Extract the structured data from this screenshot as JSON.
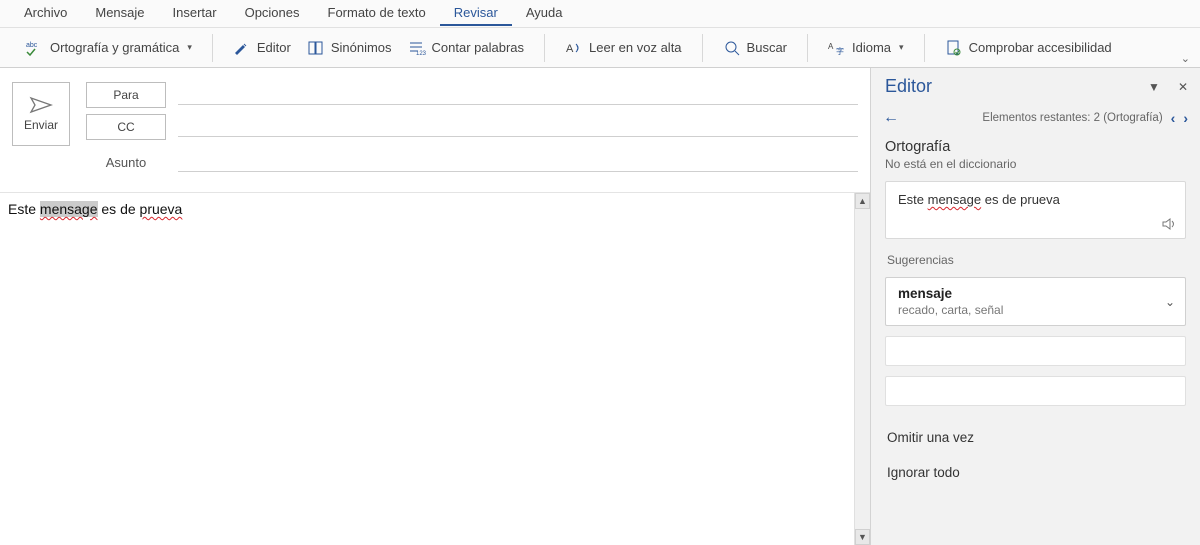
{
  "menu": {
    "items": [
      "Archivo",
      "Mensaje",
      "Insertar",
      "Opciones",
      "Formato de texto",
      "Revisar",
      "Ayuda"
    ],
    "active_index": 5
  },
  "ribbon": {
    "spelling": "Ortografía y gramática",
    "editor": "Editor",
    "synonyms": "Sinónimos",
    "wordcount": "Contar palabras",
    "readaloud": "Leer en voz alta",
    "search": "Buscar",
    "language": "Idioma",
    "a11y": "Comprobar accesibilidad"
  },
  "compose": {
    "send": "Enviar",
    "to": "Para",
    "cc": "CC",
    "subject_label": "Asunto",
    "body_pre": "Este ",
    "body_err1": "mensage",
    "body_mid": " es de ",
    "body_err2": "prueva"
  },
  "editor_pane": {
    "title": "Editor",
    "remaining": "Elementos restantes: 2 (Ortografía)",
    "section": "Ortografía",
    "not_in_dict": "No está en el diccionario",
    "context_pre": "Este ",
    "context_err": "mensage",
    "context_post": " es de prueva",
    "suggestions_label": "Sugerencias",
    "suggestion_main": "mensaje",
    "suggestion_sub": "recado, carta, señal",
    "skip_once": "Omitir una vez",
    "ignore_all": "Ignorar todo"
  }
}
